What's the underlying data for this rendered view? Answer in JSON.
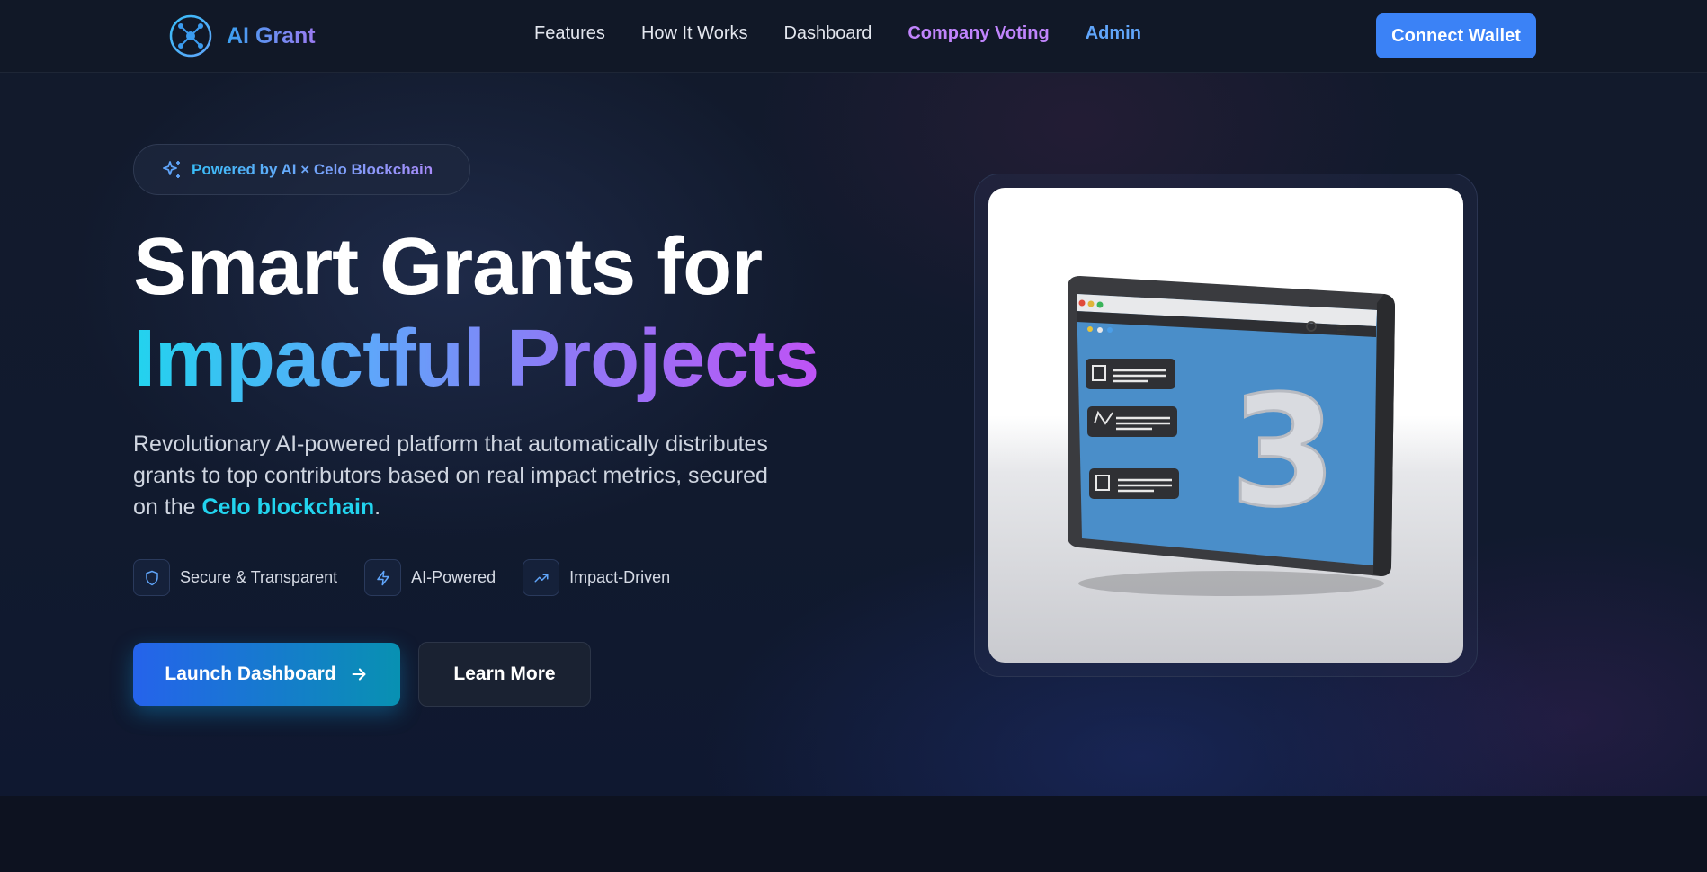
{
  "brand": {
    "name": "AI Grant",
    "logo_icon": "network-node-icon"
  },
  "nav": {
    "links": [
      "Features",
      "How It Works",
      "Dashboard",
      "Company Voting",
      "Admin"
    ],
    "cta": "Connect Wallet"
  },
  "hero": {
    "badge": "Powered by AI × Celo Blockchain",
    "title_line1": "Smart Grants for",
    "title_line2": "Impactful Projects",
    "description_before": "Revolutionary AI-powered platform that automatically distributes grants to top contributors based on real impact metrics, secured on the ",
    "description_highlight": "Celo blockchain",
    "description_after": ".",
    "features": [
      {
        "label": "Secure & Transparent",
        "icon": "shield-icon"
      },
      {
        "label": "AI-Powered",
        "icon": "lightning-icon"
      },
      {
        "label": "Impact-Driven",
        "icon": "trending-up-icon"
      }
    ],
    "primary_button": "Launch Dashboard",
    "secondary_button": "Learn More"
  },
  "illustration": {
    "icon": "browser-window-3d-illustration",
    "digit": "3"
  },
  "colors": {
    "background": "#0d1220",
    "accent_blue": "#3b82f6",
    "accent_cyan": "#22d3ee",
    "accent_purple": "#c084fc"
  }
}
